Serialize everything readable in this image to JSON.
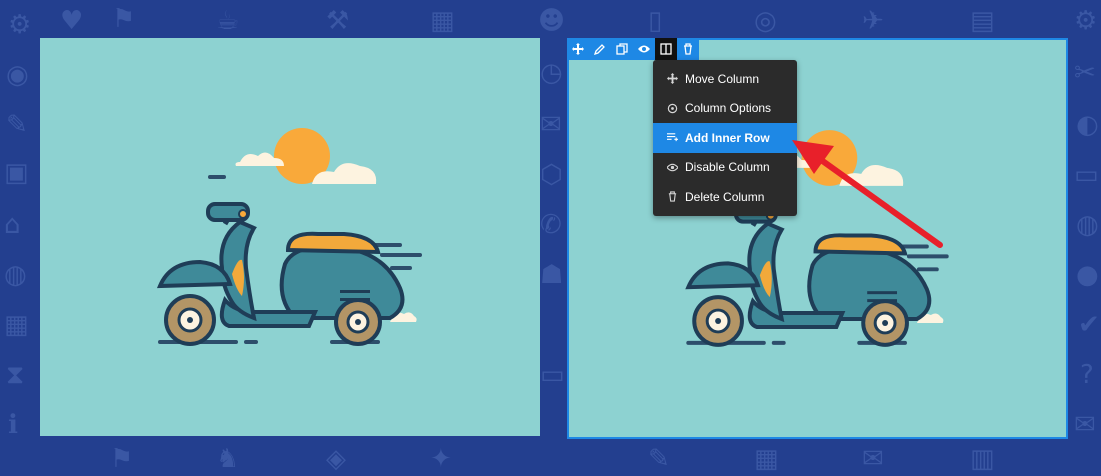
{
  "colors": {
    "page_background": "#233f8f",
    "panel_background": "#8dd2d1",
    "accent": "#1e88e5",
    "menu_background": "#2b2b2b",
    "annotation_arrow": "#e8202a"
  },
  "toolbar": {
    "buttons": [
      {
        "icon": "move-icon"
      },
      {
        "icon": "pencil-icon"
      },
      {
        "icon": "duplicate-icon"
      },
      {
        "icon": "eye-icon"
      },
      {
        "icon": "columns-icon"
      },
      {
        "icon": "trash-icon"
      }
    ]
  },
  "column_menu": {
    "items": [
      {
        "label": "Move Column",
        "icon": "move-icon"
      },
      {
        "label": "Column Options",
        "icon": "gear-icon"
      },
      {
        "label": "Add Inner Row",
        "icon": "add-row-icon",
        "highlighted": true
      },
      {
        "label": "Disable Column",
        "icon": "eye-icon"
      },
      {
        "label": "Delete Column",
        "icon": "trash-icon"
      }
    ]
  },
  "images": [
    {
      "subject": "scooter-illustration"
    },
    {
      "subject": "scooter-illustration"
    }
  ]
}
